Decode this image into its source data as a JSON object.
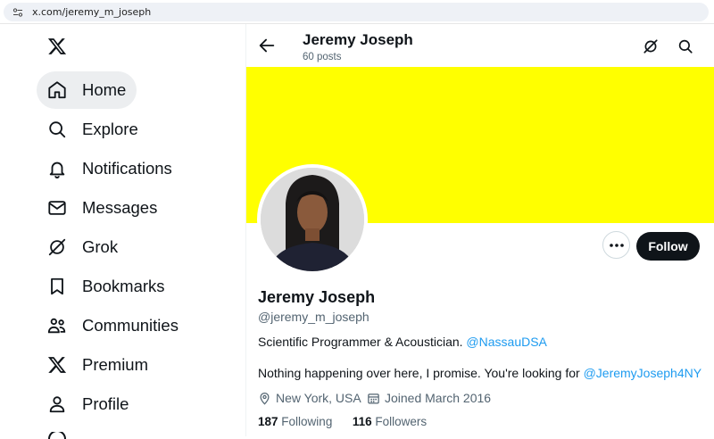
{
  "browser": {
    "url": "x.com/jeremy_m_joseph"
  },
  "nav": {
    "items": [
      {
        "label": "Home",
        "icon": "home-icon"
      },
      {
        "label": "Explore",
        "icon": "search-icon"
      },
      {
        "label": "Notifications",
        "icon": "bell-icon"
      },
      {
        "label": "Messages",
        "icon": "envelope-icon"
      },
      {
        "label": "Grok",
        "icon": "grok-icon"
      },
      {
        "label": "Bookmarks",
        "icon": "bookmark-icon"
      },
      {
        "label": "Communities",
        "icon": "people-icon"
      },
      {
        "label": "Premium",
        "icon": "x-logo-icon"
      },
      {
        "label": "Profile",
        "icon": "person-icon"
      }
    ]
  },
  "header": {
    "name": "Jeremy Joseph",
    "posts": "60 posts"
  },
  "profile": {
    "name": "Jeremy Joseph",
    "handle": "@jeremy_m_joseph",
    "bio_text": "Scientific Programmer & Acoustician. ",
    "bio_link": "@NassauDSA",
    "note_text": "Nothing happening over here, I promise. You're looking for ",
    "note_link": "@JeremyJoseph4NY",
    "location": "New York, USA",
    "joined": "Joined March 2016",
    "following_count": "187",
    "following_label": "Following",
    "followers_count": "116",
    "followers_label": "Followers"
  },
  "actions": {
    "follow_label": "Follow"
  },
  "colors": {
    "banner": "#ffff00",
    "link": "#1d9bf0",
    "follow_bg": "#0f1419"
  }
}
